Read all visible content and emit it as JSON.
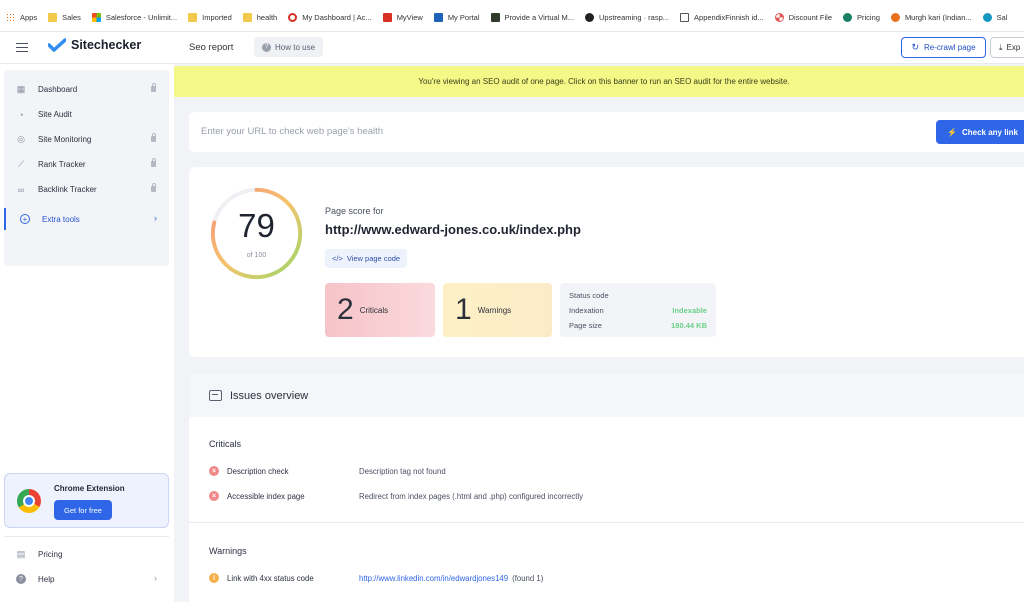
{
  "bookmarks": [
    {
      "label": "Apps",
      "icon": "apps-grid-icon",
      "color": "#e8711c"
    },
    {
      "label": "Sales",
      "icon": "folder-icon",
      "color": "#f2c94c"
    },
    {
      "label": "Salesforce - Unlimit...",
      "icon": "microsoft-logo-icon",
      "color": "#f25022"
    },
    {
      "label": "Imported",
      "icon": "folder-icon",
      "color": "#f2c94c"
    },
    {
      "label": "health",
      "icon": "folder-icon",
      "color": "#f2c94c"
    },
    {
      "label": "My Dashboard | Ac...",
      "icon": "opera-icon",
      "color": "#d93025"
    },
    {
      "label": "MyView",
      "icon": "myview-icon",
      "color": "#d93025"
    },
    {
      "label": "My Portal",
      "icon": "portal-icon",
      "color": "#1e63b8"
    },
    {
      "label": "Provide a Virtual M...",
      "icon": "dark-logo-icon",
      "color": "#2f3b2a"
    },
    {
      "label": "Upstreaming · rasp...",
      "icon": "github-icon",
      "color": "#222222"
    },
    {
      "label": "AppendixFinnish id...",
      "icon": "wiki-icon",
      "color": "#555555"
    },
    {
      "label": "Discount File",
      "icon": "pinwheel-icon",
      "color": "#e05a5a"
    },
    {
      "label": "Pricing",
      "icon": "s-logo-icon",
      "color": "#1a7f64"
    },
    {
      "label": "Murgh kari (Indian...",
      "icon": "recipe-icon",
      "color": "#e8711c"
    },
    {
      "label": "Sal",
      "icon": "salesforce-cloud-icon",
      "color": "#1798c1"
    }
  ],
  "header": {
    "brand": "Sitechecker",
    "section_title": "Seo report",
    "how_to": "How to use",
    "recrawl": "Re-crawl page",
    "export": "Exp"
  },
  "sidebar": {
    "items": [
      {
        "label": "Dashboard",
        "icon": "dashboard-icon",
        "locked": true
      },
      {
        "label": "Site Audit",
        "icon": "gauge-icon",
        "locked": false
      },
      {
        "label": "Site Monitoring",
        "icon": "monitoring-icon",
        "locked": true
      },
      {
        "label": "Rank Tracker",
        "icon": "trend-icon",
        "locked": true
      },
      {
        "label": "Backlink Tracker",
        "icon": "link-icon",
        "locked": true
      }
    ],
    "extra_tools": "Extra tools",
    "extension": {
      "title": "Chrome Extension",
      "button": "Get for free"
    },
    "bottom": [
      {
        "label": "Pricing",
        "icon": "pricing-icon"
      },
      {
        "label": "Help",
        "icon": "help-icon"
      }
    ]
  },
  "banner": "You're viewing an SEO audit of one page. Click on this banner to run an SEO audit for the entire website.",
  "url_bar": {
    "placeholder": "Enter your URL to check web page's health",
    "button": "Check any link"
  },
  "score": {
    "value": "79",
    "of": "of 100",
    "fraction": 0.79,
    "label": "Page score for",
    "url": "http://www.edward-jones.co.uk/index.php",
    "view_code": "View page code",
    "criticals_count": "2",
    "criticals_label": "Criticals",
    "warnings_count": "1",
    "warnings_label": "Warnings",
    "status": {
      "status_code_label": "Status code",
      "indexation_label": "Indexation",
      "indexation_value": "Indexable",
      "page_size_label": "Page size",
      "page_size_value": "180.44 KB"
    }
  },
  "issues": {
    "title": "Issues overview",
    "criticals_title": "Criticals",
    "criticals": [
      {
        "name": "Description check",
        "desc": "Description tag not found"
      },
      {
        "name": "Accessible index page",
        "desc": "Redirect from index pages (.html and .php) configured incorrectly"
      }
    ],
    "warnings_title": "Warnings",
    "warnings": [
      {
        "name": "Link with 4xx status code",
        "link": "http://www.linkedin.com/in/edwardjones149",
        "found": "(found 1)"
      }
    ]
  },
  "colors": {
    "accent": "#2f66e8",
    "banner": "#f4f886",
    "critical": "#f08a8a",
    "warning": "#f6b04b",
    "ok": "#6ccf8a"
  }
}
